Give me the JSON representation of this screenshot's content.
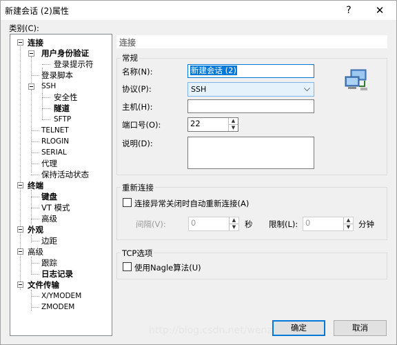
{
  "window": {
    "title": "新建会话 (2)属性",
    "help_glyph": "?",
    "close_glyph": "✕"
  },
  "category_label": "类别(C):",
  "tree": {
    "connection": "连接",
    "auth": "用户身份验证",
    "login_prompt": "登录提示符",
    "login_script": "登录脚本",
    "ssh": "SSH",
    "security": "安全性",
    "tunnel": "隧道",
    "sftp": "SFTP",
    "telnet": "TELNET",
    "rlogin": "RLOGIN",
    "serial": "SERIAL",
    "proxy": "代理",
    "keepalive": "保持活动状态",
    "terminal": "终端",
    "keyboard": "键盘",
    "vt_mode": "VT 模式",
    "term_advanced": "高级",
    "appearance": "外观",
    "margin": "边距",
    "advanced": "高级",
    "trace": "跟踪",
    "logging": "日志记录",
    "file_transfer": "文件传输",
    "xymodem": "X/YMODEM",
    "zmodem": "ZMODEM"
  },
  "panel": {
    "header": "连接",
    "general": {
      "label": "常规",
      "name_label": "名称(N):",
      "name_value": "新建会话 (2)",
      "protocol_label": "协议(P):",
      "protocol_value": "SSH",
      "host_label": "主机(H):",
      "host_value": "",
      "port_label": "端口号(O):",
      "port_value": "22",
      "desc_label": "说明(D):",
      "desc_value": ""
    },
    "reconnect": {
      "label": "重新连接",
      "auto_label": "连接异常关闭时自动重新连接(A)",
      "interval_label": "间隔(V):",
      "interval_value": "0",
      "sec_unit": "秒",
      "limit_label": "限制(L):",
      "limit_value": "0",
      "min_unit": "分钟"
    },
    "tcp": {
      "label": "TCP选项",
      "nagle_label": "使用Nagle算法(U)"
    }
  },
  "buttons": {
    "ok": "确定",
    "cancel": "取消"
  },
  "watermark": "http://blog.csdn.net/wenzhi_ig10"
}
